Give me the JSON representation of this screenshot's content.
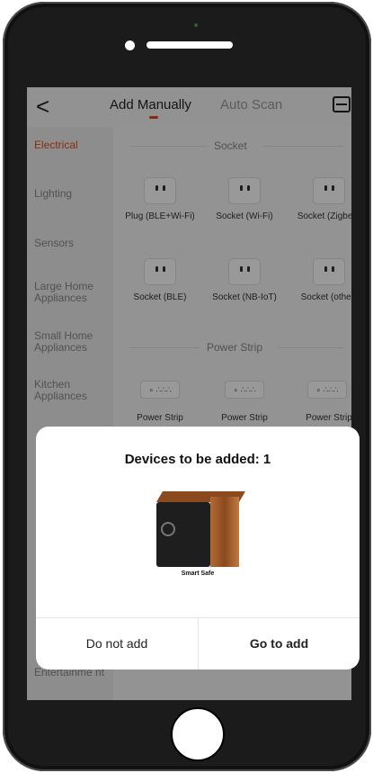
{
  "header": {
    "back_glyph": "<",
    "tab_manual": "Add Manually",
    "tab_auto": "Auto Scan",
    "scan_icon": "scan-icon"
  },
  "sidebar": {
    "items": [
      {
        "label": "Electrical",
        "active": true
      },
      {
        "label": "Lighting"
      },
      {
        "label": "Sensors"
      },
      {
        "label": "Large Home Appliances"
      },
      {
        "label": "Small Home Appliances"
      },
      {
        "label": "Kitchen Appliances"
      },
      {
        "label": "Entertainme nt"
      }
    ]
  },
  "content": {
    "socket_title": "Socket",
    "power_strip_title": "Power Strip",
    "devices": [
      {
        "label": "Plug (BLE+Wi-Fi)"
      },
      {
        "label": "Socket (Wi-Fi)"
      },
      {
        "label": "Socket (Zigbee)"
      },
      {
        "label": "Socket (BLE)"
      },
      {
        "label": "Socket (NB-IoT)"
      },
      {
        "label": "Socket (other)"
      }
    ],
    "strips": [
      {
        "label": "Power Strip"
      },
      {
        "label": "Power Strip"
      },
      {
        "label": "Power Strip"
      }
    ]
  },
  "dialog": {
    "title": "Devices to be added: 1",
    "device_name": "Smart Safe",
    "btn_cancel": "Do not add",
    "btn_confirm": "Go to add"
  },
  "colors": {
    "accent": "#e5481d"
  }
}
